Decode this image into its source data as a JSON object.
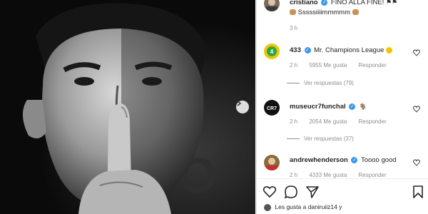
{
  "post": {
    "author": "cristiano",
    "caption": "FINO ALLA FINE!",
    "caption_line2": "Sssssiiiimmmmm",
    "time": "3 h"
  },
  "comments": [
    {
      "user": "433",
      "text": "Mr. Champions League",
      "time": "2 h",
      "likes": "5955 Me gusta",
      "reply": "Responder",
      "view_replies": "Ver respuestas (79)",
      "avatar_color": "#f2c500"
    },
    {
      "user": "museucr7funchal",
      "text": "",
      "time": "2 h",
      "likes": "2054 Me gusta",
      "reply": "Responder",
      "view_replies": "Ver respuestas (37)",
      "avatar_color": "#111111"
    },
    {
      "user": "andrewhenderson",
      "text": "Toooo good",
      "time": "2 h",
      "likes": "4333 Me gusta",
      "reply": "Responder",
      "avatar_color": "#8a6a3a"
    }
  ],
  "likes_line": "Les gusta a daniruiiz14 y",
  "colors": {
    "verified": "#3897f0",
    "text": "#262626",
    "muted": "#8e8e8e"
  }
}
